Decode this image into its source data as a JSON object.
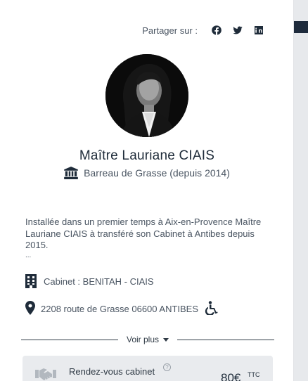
{
  "share": {
    "label": "Partager sur :",
    "networks": [
      "facebook-icon",
      "twitter-icon",
      "linkedin-icon"
    ]
  },
  "profile": {
    "name": "Maître Lauriane CIAIS",
    "bar": "Barreau de Grasse (depuis 2014)"
  },
  "bio": {
    "text": "Installée dans un premier temps à Aix-en-Provence Maître Lauriane CIAIS à transféré son Cabinet à Antibes depuis 2015.",
    "ellipsis": "..."
  },
  "cabinet": {
    "label": "Cabinet : BENITAH - CIAIS"
  },
  "address": {
    "text": "2208 route de Grasse 06600 ANTIBES"
  },
  "voir_plus": {
    "label": "Voir plus"
  },
  "rdv": {
    "label": "Rendez-vous cabinet",
    "info": "?",
    "price": "80€",
    "tax": "TTC"
  },
  "colors": {
    "text_dark": "#1f2c3a",
    "text_muted": "#4a5562",
    "card_bg": "#ffffff",
    "rdv_bg": "#e9ebee"
  }
}
